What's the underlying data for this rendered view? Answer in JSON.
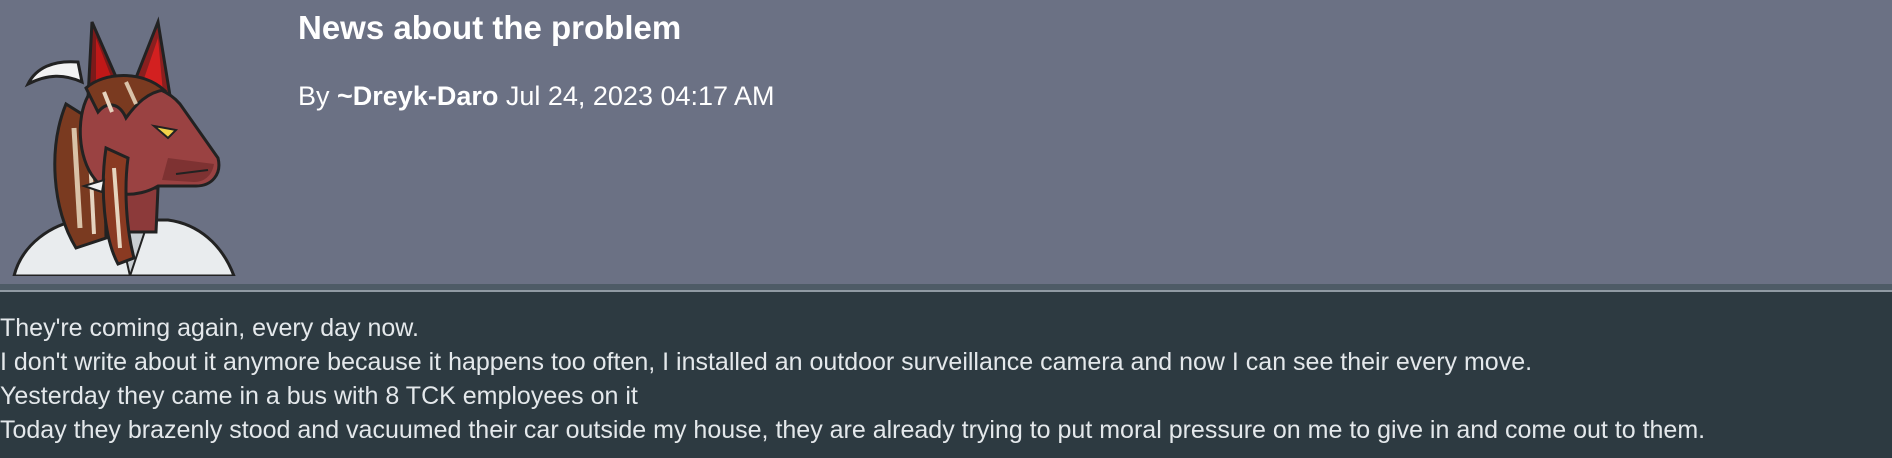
{
  "post": {
    "title": "News about the problem",
    "by_label": "By ",
    "author": "~Dreyk-Daro",
    "date": " Jul 24, 2023 04:17 AM",
    "avatar_icon": "red-dragon-avatar",
    "body": [
      "They're coming again, every day now.",
      "I don't write about it anymore because it happens too often, I installed an outdoor surveillance camera and now I can see their every move.",
      "Yesterday they came in a bus with 8 TCK employees on it",
      "Today they brazenly stood and vacuumed their car outside my house, they are already trying to put moral pressure on me to give in and come out to them."
    ]
  },
  "colors": {
    "header_bg": "#6b7184",
    "body_bg": "#2d3a41",
    "body_text": "#e4e8eb"
  }
}
